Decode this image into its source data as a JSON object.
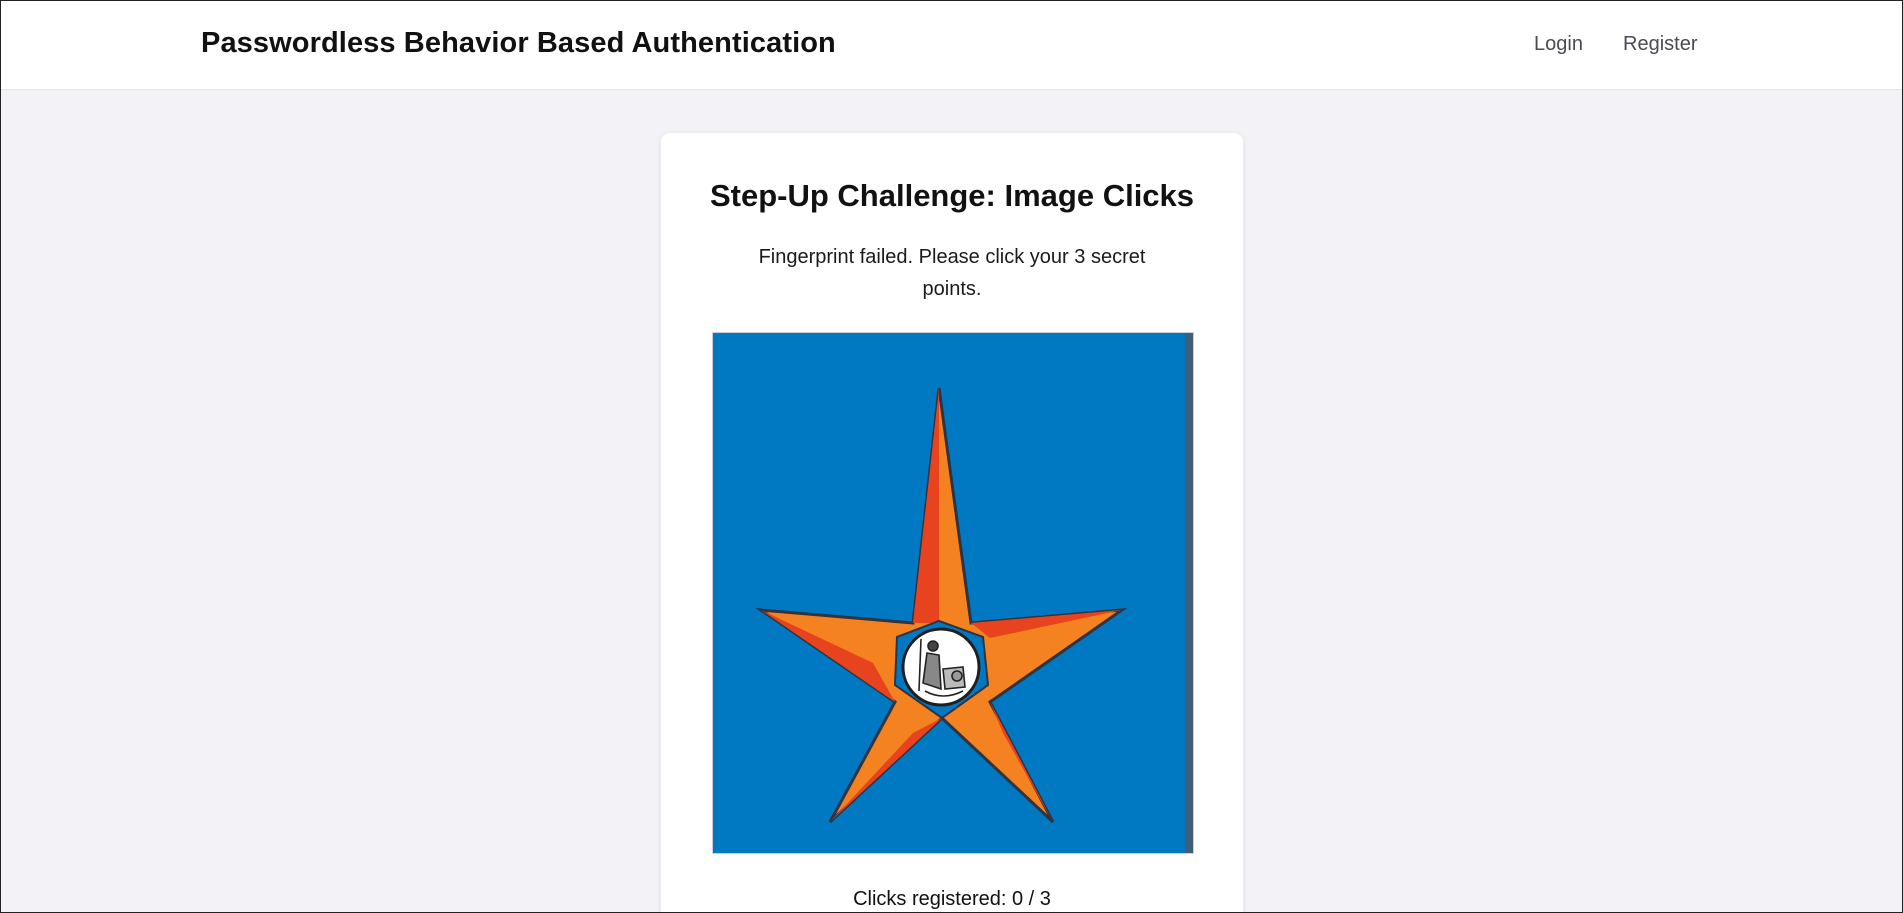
{
  "header": {
    "title": "Passwordless Behavior Based Authentication",
    "nav": {
      "login_label": "Login",
      "register_label": "Register"
    }
  },
  "challenge": {
    "title": "Step-Up Challenge: Image Clicks",
    "description": "Fingerprint failed. Please click your 3 secret points.",
    "image_icon": "star-emblem-image",
    "clicks_label": "Clicks registered: 0 / 3",
    "clicks_registered": 0,
    "clicks_required": 3
  },
  "colors": {
    "page_background": "#f2f2f7",
    "image_background": "#0079c2",
    "star_orange": "#f58220",
    "star_red": "#e8431f"
  }
}
